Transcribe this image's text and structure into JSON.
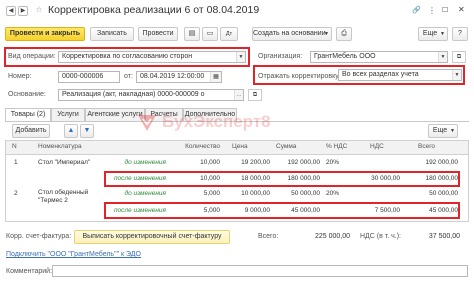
{
  "window": {
    "title": "Корректировка реализации 6 от 08.04.2019",
    "star": "☆"
  },
  "toolbar": {
    "post_close": "Провести и закрыть",
    "save": "Записать",
    "post": "Провести",
    "create_based": "Создать на основании",
    "more": "Еще"
  },
  "form": {
    "operation_label": "Вид операции:",
    "operation_value": "Корректировка по согласованию сторон",
    "org_label": "Организация:",
    "org_value": "ГрантМебель ООО",
    "number_label": "Номер:",
    "number_value": "0000-000006",
    "date_sep": "от:",
    "date_value": "08.04.2019 12:00:00",
    "reflect_label": "Отражать корректировку:",
    "reflect_value": "Во всех разделах учета",
    "basis_label": "Основание:",
    "basis_value": "Реализация (акт, накладная) 0000-000009 о"
  },
  "tabs": [
    "Товары (2)",
    "Услуги",
    "Агентские услуги",
    "Расчеты",
    "Дополнительно"
  ],
  "table_toolbar": {
    "add": "Добавить",
    "more": "Еще"
  },
  "table": {
    "headers": [
      "N",
      "Номенклатура",
      "",
      "Количество",
      "Цена",
      "Сумма",
      "% НДС",
      "НДС",
      "Всего"
    ],
    "rows": [
      {
        "n": "1",
        "name": "Стол \"Империал\"",
        "state": "до изменения",
        "qty": "10,000",
        "price": "19 200,00",
        "sum": "192 000,00",
        "vat_rate": "20%",
        "vat": "",
        "total": "192 000,00"
      },
      {
        "n": "",
        "name": "",
        "state": "после изменения",
        "qty": "10,000",
        "price": "18 000,00",
        "sum": "180 000,00",
        "vat_rate": "",
        "vat": "30 000,00",
        "total": "180 000,00"
      },
      {
        "n": "2",
        "name": "Стол обеденный \"Термес 2",
        "state": "до изменения",
        "qty": "5,000",
        "price": "10 000,00",
        "sum": "50 000,00",
        "vat_rate": "20%",
        "vat": "",
        "total": "50 000,00"
      },
      {
        "n": "",
        "name": "",
        "state": "после изменения",
        "qty": "5,000",
        "price": "9 000,00",
        "sum": "45 000,00",
        "vat_rate": "",
        "vat": "7 500,00",
        "total": "45 000,00"
      }
    ]
  },
  "footer": {
    "invoice_label": "Корр. счет-фактура:",
    "invoice_button": "Выписать корректировочный счет-фактуру",
    "total_label": "Всего:",
    "total_value": "225 000,00",
    "vat_label": "НДС (в т. ч.):",
    "vat_value": "37 500,00",
    "edo_link": "Подключить \"ООО \"ГрантМебель\"\" к ЭДО",
    "comment_label": "Комментарий:"
  },
  "watermark": "БухЭксперт8",
  "colors": {
    "accent_red": "#e0242a",
    "primary_button": "#f7d22a",
    "green_text": "#2e8b3a",
    "link": "#3b6fb6"
  }
}
